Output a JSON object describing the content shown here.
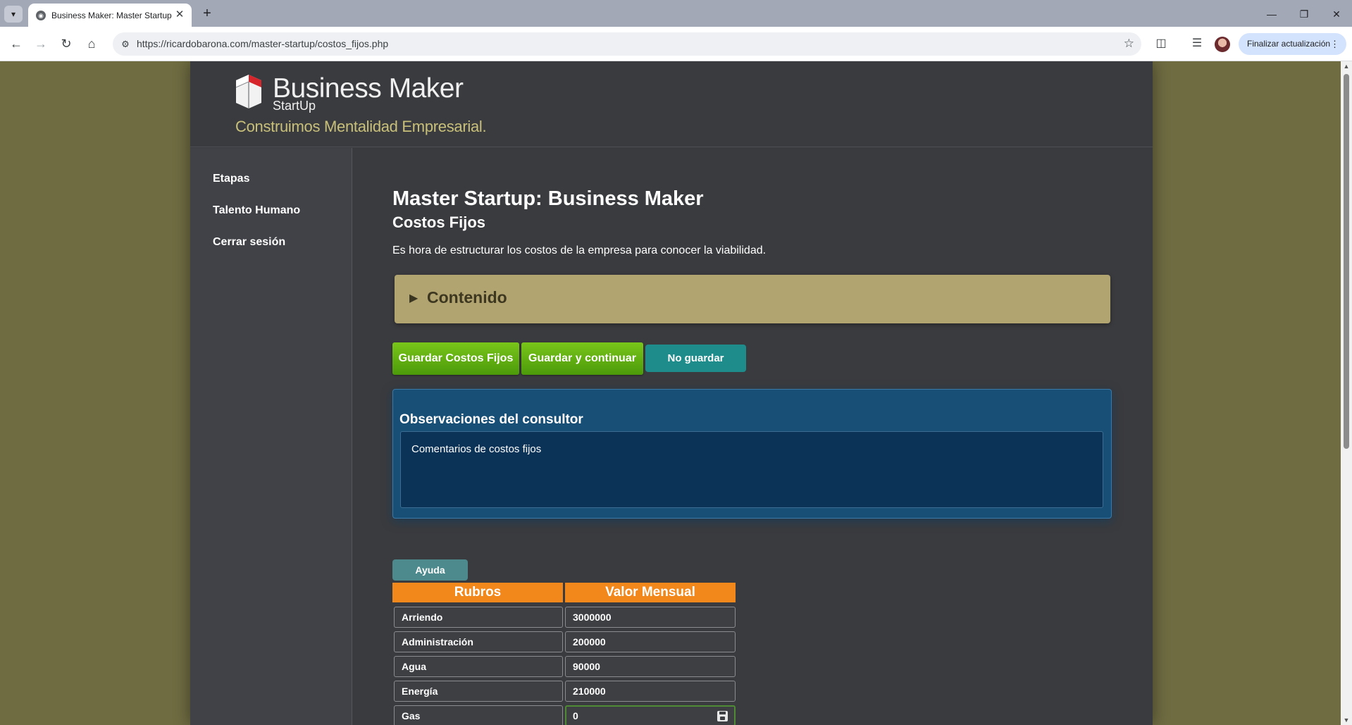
{
  "browser": {
    "tab_title": "Business Maker: Master Startup",
    "url": "https://ricardobarona.com/master-startup/costos_fijos.php",
    "update_button": "Finalizar actualización"
  },
  "brand": {
    "name": "Business Maker",
    "sub": "StartUp",
    "tagline": "Construimos Mentalidad Empresarial."
  },
  "sidebar": {
    "items": [
      {
        "label": "Etapas"
      },
      {
        "label": "Talento Humano"
      },
      {
        "label": "Cerrar sesión"
      }
    ]
  },
  "main": {
    "title": "Master Startup: Business Maker",
    "subtitle": "Costos Fijos",
    "intro": "Es hora de estructurar los costos de la empresa para conocer la viabilidad.",
    "accordion_label": "Contenido",
    "buttons": {
      "save": "Guardar Costos Fijos",
      "save_continue": "Guardar y continuar",
      "no_save": "No guardar"
    },
    "observations": {
      "title": "Observaciones del consultor",
      "text": "Comentarios de costos fijos"
    },
    "help_label": "Ayuda",
    "table": {
      "headers": [
        "Rubros",
        "Valor Mensual"
      ],
      "rows": [
        {
          "rubro": "Arriendo",
          "valor": "3000000"
        },
        {
          "rubro": "Administración",
          "valor": "200000"
        },
        {
          "rubro": "Agua",
          "valor": "90000"
        },
        {
          "rubro": "Energía",
          "valor": "210000"
        },
        {
          "rubro": "Gas",
          "valor": "0"
        }
      ]
    }
  },
  "colors": {
    "page_bg": "#6f6c42",
    "container_bg": "#3a3b3e",
    "accent_orange": "#f2871c",
    "accent_green": "#5fae12",
    "accent_teal": "#1f8c8c",
    "accordion_bg": "#b1a471"
  }
}
